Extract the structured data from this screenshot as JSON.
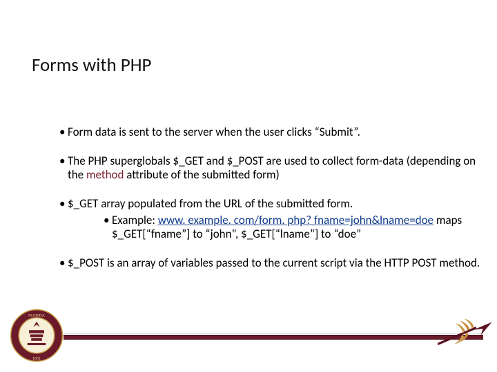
{
  "title": "Forms with PHP",
  "bullets": {
    "b1": "Form data is sent to the server when the user clicks “Submit”.",
    "b2_pre": "The PHP superglobals $_GET and $_POST are used to collect form-data (depending on the ",
    "b2_method": "method",
    "b2_post": " attribute of the submitted form)",
    "b3": "$_GET array populated from the URL of the submitted form.",
    "b3_sub_label": "Example: ",
    "b3_sub_link": "www. example. com/form. php? fname=john&lname=doe",
    "b3_sub_tail": " maps $_GET[“fname”] to “john”, $_GET[“lname”]  to “doe”",
    "b4": "$_POST is an array of variables passed to the current script via the HTTP POST method."
  },
  "footer": {
    "seal_label": "Florida State University Seal 1851",
    "spear_label": "Seminole spear"
  }
}
